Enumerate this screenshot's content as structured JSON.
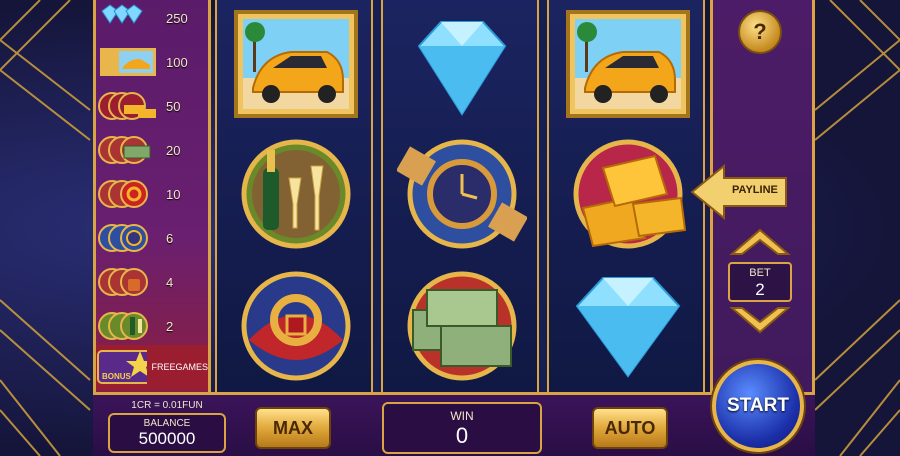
{
  "paytable": {
    "rows": [
      {
        "symbol": "diamond-icon",
        "payout": "250"
      },
      {
        "symbol": "car-icon",
        "payout": "100"
      },
      {
        "symbol": "gold-bars-icon",
        "payout": "50"
      },
      {
        "symbol": "cash-icon",
        "payout": "20"
      },
      {
        "symbol": "ring-icon",
        "payout": "10"
      },
      {
        "symbol": "watch-icon",
        "payout": "6"
      },
      {
        "symbol": "perfume-icon",
        "payout": "4"
      },
      {
        "symbol": "champagne-icon",
        "payout": "2"
      }
    ],
    "bonus_label": "FREEGAMES",
    "bonus_symbol_text": "BONUS"
  },
  "reels": [
    [
      "car-icon",
      "champagne-icon",
      "ring-icon"
    ],
    [
      "diamond-icon",
      "watch-icon",
      "cash-icon"
    ],
    [
      "car-icon",
      "gold-bars-icon",
      "diamond-icon"
    ]
  ],
  "controls": {
    "help_label": "?",
    "payline_label": "PAYLINE",
    "bet_label": "BET",
    "bet_value": "2",
    "credit_rate": "1CR = 0.01FUN",
    "balance_label": "BALANCE",
    "balance_value": "500000",
    "max_label": "MAX",
    "win_label": "WIN",
    "win_value": "0",
    "auto_label": "AUTO",
    "start_label": "START"
  },
  "colors": {
    "gold": "#d9a441",
    "purple_panel": "#5a1c6a",
    "reel_bg": "#161f52",
    "start_blue": "#1b2fa8"
  }
}
